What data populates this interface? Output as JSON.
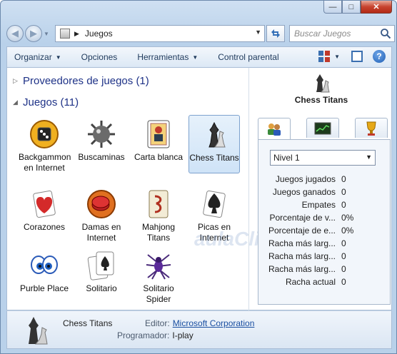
{
  "window": {
    "caption": {
      "minimize": "—",
      "maximize": "□",
      "close": "✕"
    }
  },
  "nav": {
    "back": "◀",
    "forward": "▶",
    "breadcrumb": "Juegos",
    "search_placeholder": "Buscar Juegos"
  },
  "toolbar": {
    "organize": "Organizar",
    "options": "Opciones",
    "tools": "Herramientas",
    "parental": "Control parental"
  },
  "groups": {
    "providers": "Proveedores de juegos (1)",
    "games": "Juegos (11)"
  },
  "games": [
    {
      "label": "Backgammon en Internet",
      "icon": "backgammon-icon"
    },
    {
      "label": "Buscaminas",
      "icon": "mine-icon"
    },
    {
      "label": "Carta blanca",
      "icon": "freecell-icon"
    },
    {
      "label": "Chess Titans",
      "icon": "chess-icon",
      "selected": true
    },
    {
      "label": "Corazones",
      "icon": "hearts-icon"
    },
    {
      "label": "Damas en Internet",
      "icon": "checkers-icon"
    },
    {
      "label": "Mahjong Titans",
      "icon": "mahjong-icon"
    },
    {
      "label": "Picas en Internet",
      "icon": "spades-icon"
    },
    {
      "label": "Purble Place",
      "icon": "purble-icon"
    },
    {
      "label": "Solitario",
      "icon": "solitaire-icon"
    },
    {
      "label": "Solitario Spider",
      "icon": "spider-icon"
    }
  ],
  "detail_panel": {
    "title": "Chess Titans",
    "tabs": [
      "users-stats-tab",
      "performance-tab",
      "trophy-tab"
    ],
    "level": "Nivel 1",
    "stats": [
      {
        "label": "Juegos jugados",
        "value": "0"
      },
      {
        "label": "Juegos ganados",
        "value": "0"
      },
      {
        "label": "Empates",
        "value": "0"
      },
      {
        "label": "Porcentaje de v...",
        "value": "0%"
      },
      {
        "label": "Porcentaje de e...",
        "value": "0%"
      },
      {
        "label": "Racha más larg...",
        "value": "0"
      },
      {
        "label": "Racha más larg...",
        "value": "0"
      },
      {
        "label": "Racha más larg...",
        "value": "0"
      },
      {
        "label": "Racha actual",
        "value": "0"
      }
    ]
  },
  "details": {
    "name": "Chess Titans",
    "editor_label": "Editor:",
    "editor_value": "Microsoft Corporation",
    "programmer_label": "Programador:",
    "programmer_value": "I-play"
  },
  "watermark": "aulaClic"
}
